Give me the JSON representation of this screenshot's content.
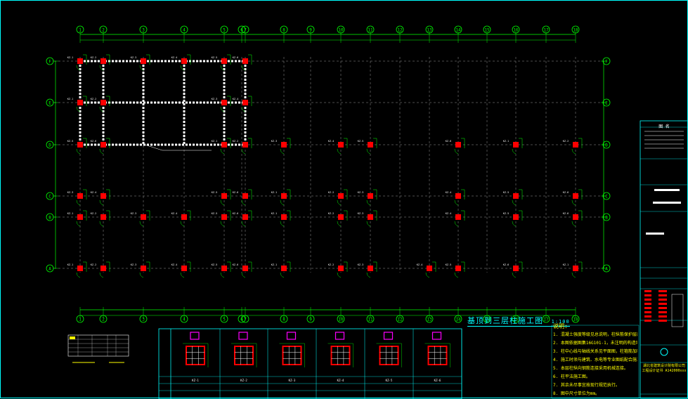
{
  "colors": {
    "background": "#000000",
    "grid_line": "#9a9a9a",
    "dimension": "#00ff00",
    "axis_bubble": "#00ff00",
    "column": "#ff0000",
    "rebar": "#ffffff",
    "wall": "#ffffff",
    "frame": "#00ffff",
    "title": "#00ffff",
    "notes": "#ffff00",
    "section_marker": "#ff00ff"
  },
  "axes": {
    "horizontal": [
      "1",
      "2",
      "3",
      "4",
      "5",
      "6",
      "7",
      "8",
      "9",
      "10",
      "11",
      "12",
      "13",
      "14",
      "15",
      "16",
      "17",
      "18"
    ],
    "horizontal_labels_top": [
      "①",
      "②",
      "③",
      "④",
      "⑤",
      "⑥",
      "⑦",
      "⑧",
      "⑨",
      "⑩",
      "⑪",
      "⑫",
      "⑬",
      "⑭",
      "⑮",
      "⑯",
      "⑰",
      "⑱"
    ],
    "vertical_labels": [
      "F",
      "E",
      "D",
      "C",
      "B",
      "A"
    ]
  },
  "drawing_title": "基顶到三层柱施工图",
  "drawing_scale": "1:100",
  "notes_title": "说明:",
  "notes": [
    "1. 混凝土强度等级见总说明，柱纵筋保护层厚度按规范执行。",
    "2. 本图依据图集16G101-1，未注明的构造均按图集要求施工。",
    "3. 柱中心线与轴线关系见平面图，柱箍筋加密区范围见图集。",
    "4. 施工时须与建筑、水电等专业图纸配合施工。",
    "5. 本层柱纵向钢筋连接采用机械连接。",
    "6. 柱平法施工图。",
    "7. 其余未尽事宜按现行规范执行。",
    "8. 图中尺寸单位为mm。"
  ],
  "column_tags": [
    "KZ-1",
    "KZ-2",
    "KZ-3",
    "KZ-4",
    "KZ-5",
    "KZ-6"
  ],
  "title_block": {
    "header": "图 名",
    "stamp": "出图专用章",
    "company": "湖北省建筑设计院有限公司",
    "sub": "工程设计证书 A142000xxx"
  }
}
